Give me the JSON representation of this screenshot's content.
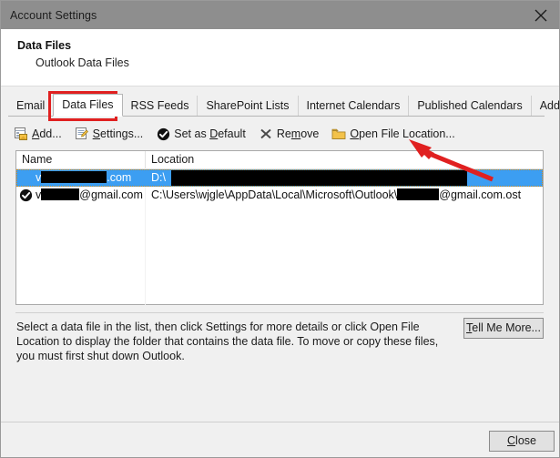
{
  "window": {
    "title": "Account Settings",
    "close_icon": "close-x-icon",
    "titlebar_color": "#8e8e8e"
  },
  "header": {
    "title": "Data Files",
    "subtitle": "Outlook Data Files"
  },
  "tabs": [
    {
      "label": "Email",
      "active": false
    },
    {
      "label": "Data Files",
      "active": true
    },
    {
      "label": "RSS Feeds",
      "active": false
    },
    {
      "label": "SharePoint Lists",
      "active": false
    },
    {
      "label": "Internet Calendars",
      "active": false
    },
    {
      "label": "Published Calendars",
      "active": false
    },
    {
      "label": "Address Books",
      "active": false
    }
  ],
  "toolbar": {
    "add": {
      "label": "Add...",
      "accel": "A",
      "icon": "add-data-file-icon"
    },
    "settings": {
      "label": "Settings...",
      "accel": "S",
      "icon": "settings-page-icon"
    },
    "set_as_default": {
      "label": "Set as Default",
      "accel": "D",
      "icon": "check-circle-icon"
    },
    "remove": {
      "label": "Remove",
      "accel": "m",
      "icon": "x-mark-icon"
    },
    "open_file_location": {
      "label": "Open File Location...",
      "accel": "O",
      "icon": "folder-icon"
    }
  },
  "list": {
    "columns": [
      "Name",
      "Location"
    ],
    "rows": [
      {
        "name_suffix": ".com",
        "name_prefix_visible": "v",
        "name_redacted": true,
        "location_prefix": "D:\\",
        "location_redacted": true,
        "is_default": false,
        "selected": true
      },
      {
        "name_prefix_visible": "v",
        "name_suffix": "@gmail.com",
        "name_redacted": true,
        "location_text": "C:\\Users\\wjgle\\AppData\\Local\\Microsoft\\Outlook\\",
        "location_suffix": "@gmail.com.ost",
        "location_redacted": true,
        "is_default": true,
        "selected": false
      }
    ]
  },
  "info": {
    "description": "Select a data file in the list, then click Settings for more details or click Open File Location to display the folder that contains the data file. To move or copy these files, you must first shut down Outlook.",
    "tell_me_more_label": "Tell Me More..."
  },
  "footer": {
    "close_label": "Close",
    "close_accel": "C"
  },
  "annotations": {
    "highlight_color": "#e02020",
    "highlight_target": "Data Files tab",
    "arrow_target": "Open File Location..."
  }
}
